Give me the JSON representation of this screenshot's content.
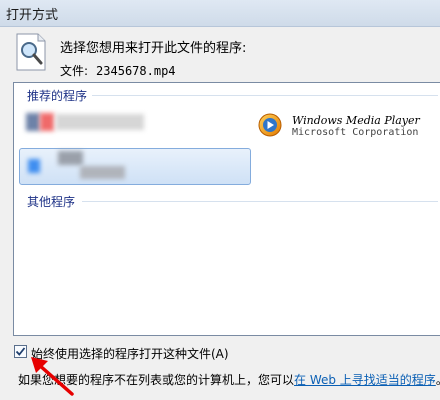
{
  "window": {
    "title": "打开方式"
  },
  "header": {
    "prompt": "选择您想用来打开此文件的程序:",
    "file_label": "文件:",
    "file_name": "2345678.mp4"
  },
  "recommended": {
    "title": "推荐的程序",
    "wmp": {
      "name": "Windows Media Player",
      "vendor": "Microsoft Corporation"
    }
  },
  "other": {
    "title": "其他程序"
  },
  "footer": {
    "always_use_label": "始终使用选择的程序打开这种文件(A)",
    "always_use_checked": true,
    "help_prefix": "如果您想要的程序不在列表或您的计算机上，您可以",
    "help_link": "在 Web 上寻找适当的程序",
    "help_suffix": "。"
  },
  "colors": {
    "accent_blue": "#1e3287",
    "link": "#0a5fb4",
    "arrow": "#e60000"
  }
}
